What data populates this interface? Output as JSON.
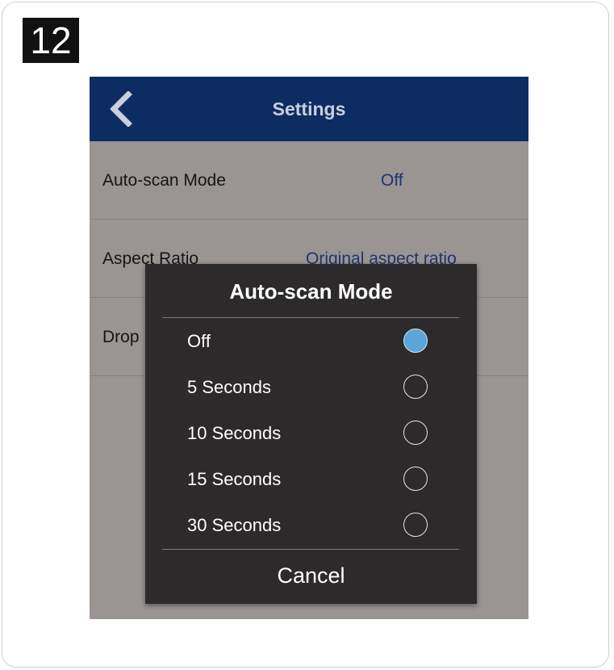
{
  "step": {
    "number": "12"
  },
  "appbar": {
    "title": "Settings",
    "back_icon": "chevron-left-icon",
    "color": "#0d2c62"
  },
  "settings": {
    "rows": [
      {
        "label": "Auto-scan Mode",
        "value": "Off"
      },
      {
        "label": "Aspect Ratio",
        "value": "Original aspect ratio"
      },
      {
        "label": "Drop",
        "value": ""
      }
    ]
  },
  "dialog": {
    "title": "Auto-scan Mode",
    "options": [
      {
        "label": "Off",
        "selected": true
      },
      {
        "label": "5 Seconds",
        "selected": false
      },
      {
        "label": "10 Seconds",
        "selected": false
      },
      {
        "label": "15 Seconds",
        "selected": false
      },
      {
        "label": "30 Seconds",
        "selected": false
      }
    ],
    "cancel_label": "Cancel",
    "accent": "#5ba6d8"
  }
}
